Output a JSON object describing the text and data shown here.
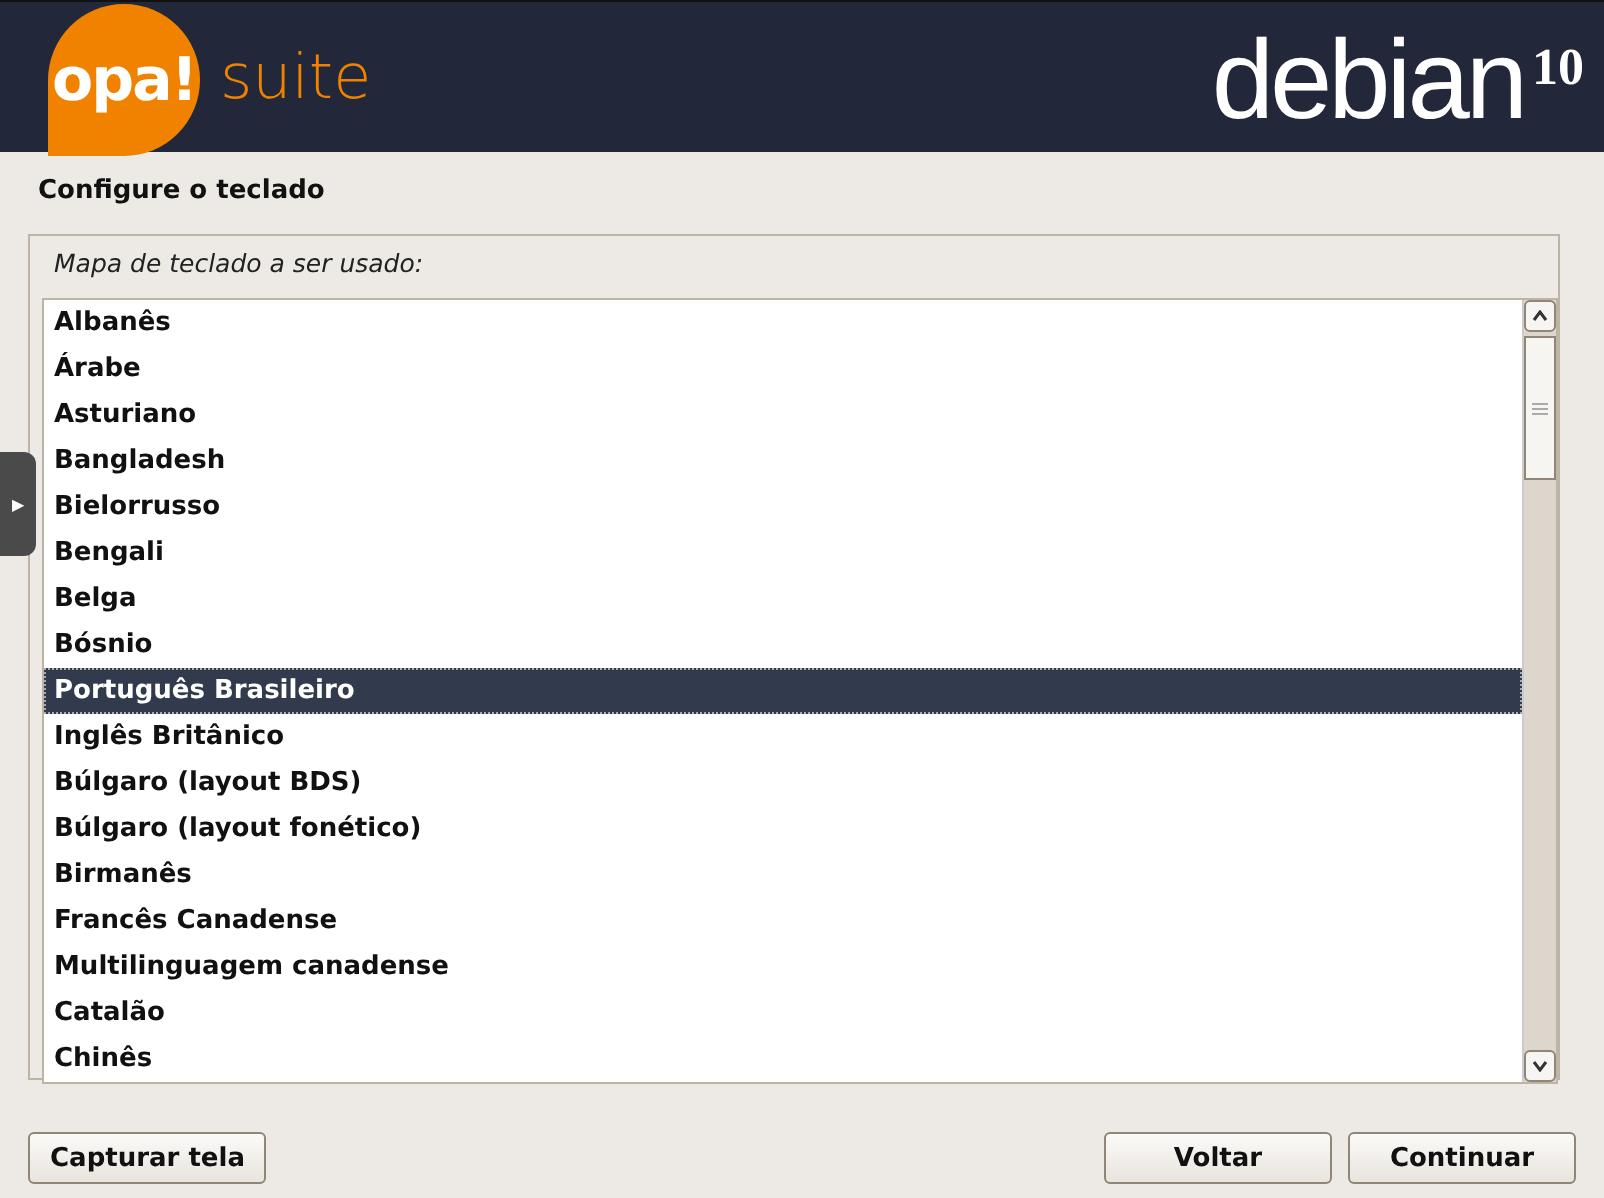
{
  "header": {
    "logo_left": {
      "mark": "opa!",
      "word": "suite"
    },
    "logo_right": {
      "word": "debian",
      "version": "10"
    }
  },
  "side_tab": {
    "glyph": "▶"
  },
  "title": "Configure o teclado",
  "list_label": "Mapa de teclado a ser usado:",
  "items": [
    {
      "label": "Albanês",
      "selected": false
    },
    {
      "label": "Árabe",
      "selected": false
    },
    {
      "label": "Asturiano",
      "selected": false
    },
    {
      "label": "Bangladesh",
      "selected": false
    },
    {
      "label": "Bielorrusso",
      "selected": false
    },
    {
      "label": "Bengali",
      "selected": false
    },
    {
      "label": "Belga",
      "selected": false
    },
    {
      "label": "Bósnio",
      "selected": false
    },
    {
      "label": "Português Brasileiro",
      "selected": true
    },
    {
      "label": "Inglês Britânico",
      "selected": false
    },
    {
      "label": "Búlgaro (layout BDS)",
      "selected": false
    },
    {
      "label": "Búlgaro (layout fonético)",
      "selected": false
    },
    {
      "label": "Birmanês",
      "selected": false
    },
    {
      "label": "Francês Canadense",
      "selected": false
    },
    {
      "label": "Multilinguagem canadense",
      "selected": false
    },
    {
      "label": "Catalão",
      "selected": false
    },
    {
      "label": "Chinês",
      "selected": false
    }
  ],
  "buttons_left": [
    "Capturar tela"
  ],
  "buttons_right": [
    "Voltar",
    "Continuar"
  ]
}
